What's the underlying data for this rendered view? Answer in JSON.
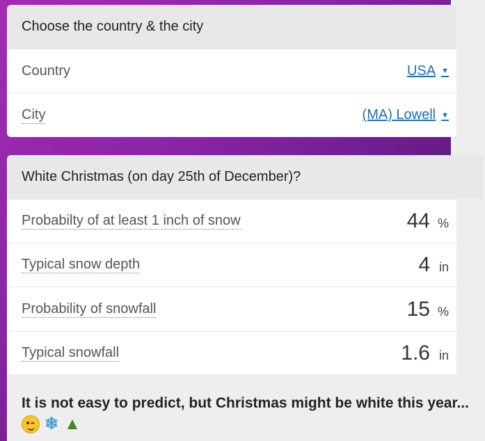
{
  "location_card": {
    "title": "Choose the country & the city",
    "country_label": "Country",
    "country_value": "USA",
    "city_label": "City",
    "city_value": "(MA) Lowell"
  },
  "christmas_card": {
    "title": "White Christmas (on day 25th of December)?",
    "rows": [
      {
        "label": "Probabilty of at least 1 inch of snow",
        "value": "44",
        "unit": "%"
      },
      {
        "label": "Typical snow depth",
        "value": "4",
        "unit": "in"
      },
      {
        "label": "Probability of snowfall",
        "value": "15",
        "unit": "%"
      },
      {
        "label": "Typical snowfall",
        "value": "1.6",
        "unit": "in"
      }
    ],
    "verdict": "It is not easy to predict, but Christmas might be white this year...",
    "emojis": [
      "winking-face",
      "snowflake",
      "christmas-tree"
    ]
  },
  "colors": {
    "link": "#1f6fb0",
    "background_gradient_start": "#a42bb5",
    "background_gradient_end": "#3a1050"
  }
}
